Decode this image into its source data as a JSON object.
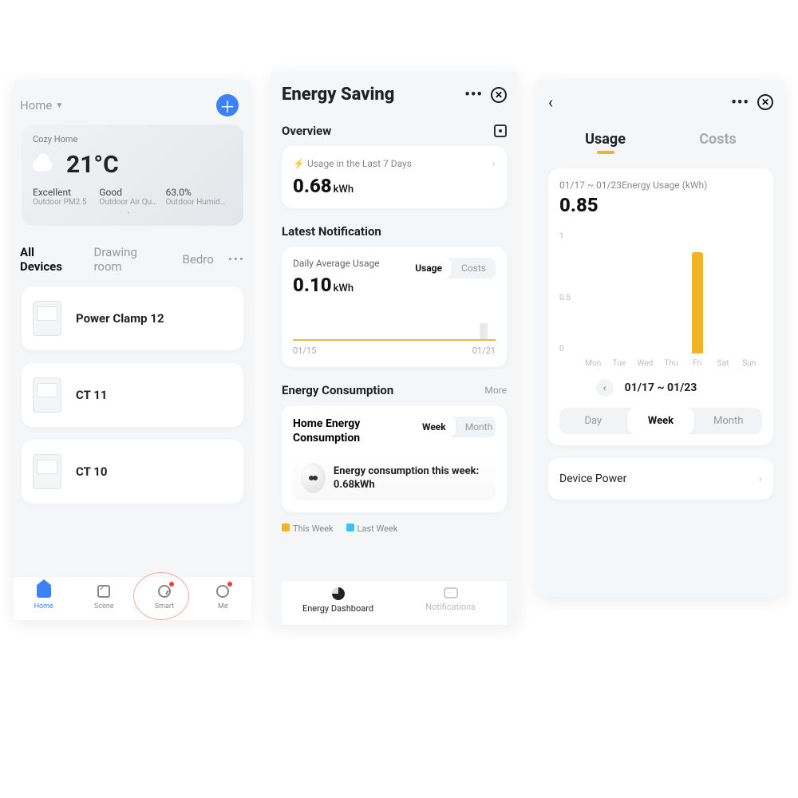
{
  "screen1": {
    "homeSelector": "Home",
    "weather": {
      "location": "Cozy Home",
      "temp": "21°C",
      "cols": [
        {
          "value": "Excellent",
          "label": "Outdoor PM2.5"
        },
        {
          "value": "Good",
          "label": "Outdoor Air Qu…"
        },
        {
          "value": "63.0%",
          "label": "Outdoor Humid…"
        }
      ]
    },
    "roomTabs": {
      "all": "All Devices",
      "t2": "Drawing room",
      "t3": "Bedro"
    },
    "devices": [
      {
        "name": "Power Clamp 12"
      },
      {
        "name": "CT 11"
      },
      {
        "name": "CT 10"
      }
    ],
    "nav": {
      "home": "Home",
      "scene": "Scene",
      "smart": "Smart",
      "me": "Me"
    }
  },
  "screen2": {
    "title": "Energy Saving",
    "overview": {
      "label": "Overview"
    },
    "usage7": {
      "label": "Usage in the Last 7 Days",
      "value": "0.68",
      "unit": "kWh"
    },
    "latest": {
      "label": "Latest Notification",
      "avgLabel": "Daily Average Usage",
      "avgValue": "0.10",
      "avgUnit": "kWh",
      "seg": {
        "usage": "Usage",
        "costs": "Costs"
      },
      "dateFrom": "01/15",
      "dateTo": "01/21"
    },
    "consumption": {
      "label": "Energy Consumption",
      "more": "More",
      "cardTitle": "Home Energy Consumption",
      "seg": {
        "week": "Week",
        "month": "Month"
      },
      "bubble": "Energy consumption this week: 0.68kWh",
      "legend": {
        "thisWeek": "This Week",
        "lastWeek": "Last Week"
      }
    },
    "bottom": {
      "dash": "Energy Dashboard",
      "notif": "Notifications"
    }
  },
  "screen3": {
    "tabs": {
      "usage": "Usage",
      "costs": "Costs"
    },
    "rangeLabel": "01/17 ~ 01/23Energy Usage  (kWh)",
    "value": "0.85",
    "yTicks": {
      "y1": "1",
      "y05": "0.5",
      "y0": "0"
    },
    "days": [
      "Mon",
      "Tue",
      "Wed",
      "Thu",
      "Fri",
      "Sat",
      "Sun"
    ],
    "rangeText": "01/17 ~ 01/23",
    "seg": {
      "day": "Day",
      "week": "Week",
      "month": "Month"
    },
    "devicePower": "Device Power"
  },
  "chart_data": {
    "type": "bar",
    "title": "Energy Usage (kWh)",
    "categories": [
      "Mon",
      "Tue",
      "Wed",
      "Thu",
      "Fri",
      "Sat",
      "Sun"
    ],
    "values": [
      0,
      0,
      0,
      0,
      0.85,
      0,
      0
    ],
    "xlabel": "",
    "ylabel": "kWh",
    "ylim": [
      0,
      1
    ]
  }
}
